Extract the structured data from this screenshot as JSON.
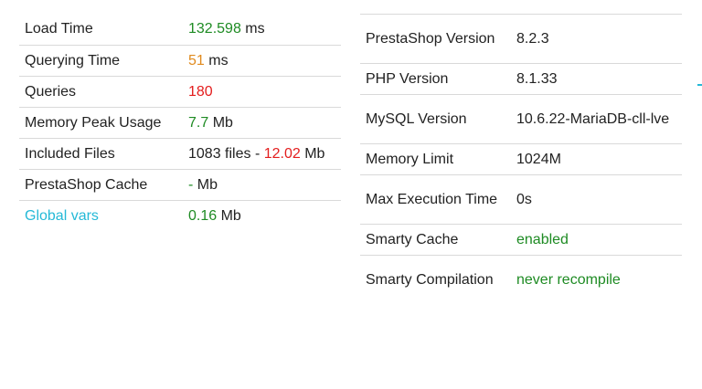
{
  "left_table": {
    "rows": [
      {
        "label": "Load Time",
        "value_parts": [
          {
            "text": "132.598",
            "color": "green"
          },
          {
            "text": " ms",
            "color": "default"
          }
        ]
      },
      {
        "label": "Querying Time",
        "value_parts": [
          {
            "text": "51",
            "color": "orange"
          },
          {
            "text": " ms",
            "color": "default"
          }
        ]
      },
      {
        "label": "Queries",
        "value_parts": [
          {
            "text": "180",
            "color": "red"
          }
        ]
      },
      {
        "label": "Memory Peak Usage",
        "value_parts": [
          {
            "text": "7.7",
            "color": "green"
          },
          {
            "text": " Mb",
            "color": "default"
          }
        ]
      },
      {
        "label": "Included Files",
        "value_parts": [
          {
            "text": "1083 files - ",
            "color": "default"
          },
          {
            "text": "12.02",
            "color": "red"
          },
          {
            "text": " Mb",
            "color": "default"
          }
        ]
      },
      {
        "label": "PrestaShop Cache",
        "value_parts": [
          {
            "text": "-",
            "color": "green"
          },
          {
            "text": " Mb",
            "color": "default"
          }
        ]
      },
      {
        "label": "Global vars",
        "label_is_link": true,
        "value_parts": [
          {
            "text": "0.16",
            "color": "green"
          },
          {
            "text": " Mb",
            "color": "default"
          }
        ]
      }
    ]
  },
  "right_table": {
    "rows": [
      {
        "label": "PrestaShop Version",
        "value": "8.2.3",
        "value_color": "default",
        "tall": true
      },
      {
        "label": "PHP Version",
        "value": "8.1.33",
        "value_color": "default",
        "tall": false
      },
      {
        "label": "MySQL Version",
        "value": "10.6.22-MariaDB-cll-lve",
        "value_color": "default",
        "tall": true
      },
      {
        "label": "Memory Limit",
        "value": "1024M",
        "value_color": "default",
        "tall": false
      },
      {
        "label": "Max Execution Time",
        "value": "0s",
        "value_color": "default",
        "tall": true
      },
      {
        "label": "Smarty Cache",
        "value": "enabled",
        "value_color": "green",
        "tall": false
      },
      {
        "label": "Smarty Compilation",
        "value": "never recompile",
        "value_color": "green",
        "tall": true
      }
    ]
  },
  "colors": {
    "green": "#1e8b23",
    "orange": "#e08a1e",
    "red": "#e31d1d",
    "link": "#25b9d7",
    "border": "#d9d9d9",
    "text": "#222222"
  }
}
